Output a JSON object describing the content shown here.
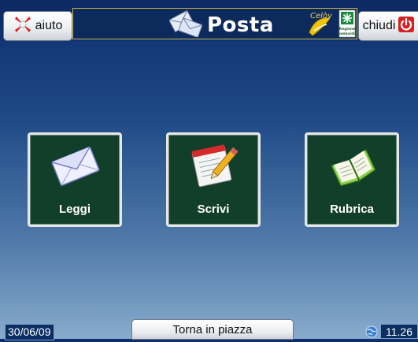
{
  "header": {
    "help_label": "aiuto",
    "title": "Posta",
    "close_label": "chiudi",
    "logo_text": "Celòy",
    "logo_region": "Regione Lombardia"
  },
  "tiles": [
    {
      "label": "Leggi",
      "icon": "envelope-icon"
    },
    {
      "label": "Scrivi",
      "icon": "write-pad-icon"
    },
    {
      "label": "Rubrica",
      "icon": "address-book-icon"
    }
  ],
  "footer": {
    "date": "30/06/09",
    "back_label": "Torna in piazza",
    "time": "11.26"
  },
  "colors": {
    "background_top": "#0d2d6e",
    "background_bottom": "#88abcc",
    "tile_green": "#123f2a",
    "title_border": "#c9b94a"
  }
}
